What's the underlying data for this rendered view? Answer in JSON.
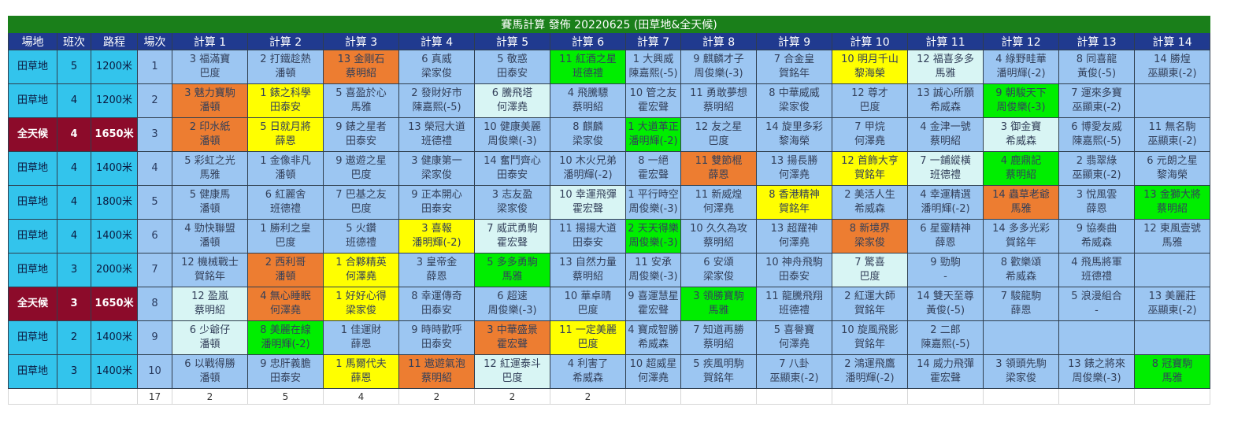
{
  "title": "賽馬計算 發佈 20220625 (田草地&全天候)",
  "headers": [
    "場地",
    "班次",
    "路程",
    "場次",
    "計算 1",
    "計算 2",
    "計算 3",
    "計算 4",
    "計算 5",
    "計算 6",
    "計算 7",
    "計算 8",
    "計算 9",
    "計算 10",
    "計算 11",
    "計算 12",
    "計算 13",
    "計算 14"
  ],
  "colors": {
    "dark": "#9cc6f2",
    "light": "#d8f5f4",
    "orange": "#ed7d31",
    "yellow": "#ffff00",
    "green": "#00ee00",
    "turf": "#33c4ec",
    "awt": "#8c0b2a",
    "header": "#203a8f",
    "title": "#1a7f1a"
  },
  "rows": [
    {
      "venue": "田草地",
      "vt": "v1",
      "cls": "5",
      "dist": "1200米",
      "race": "1",
      "cells": [
        [
          "3 福滿寶",
          "巴度",
          "d"
        ],
        [
          "2 打鐵趁熱",
          "潘頓",
          "d"
        ],
        [
          "13 金剛石",
          "蔡明紹",
          "o"
        ],
        [
          "6 真威",
          "梁家俊",
          "d"
        ],
        [
          "5 敬惑",
          "田泰安",
          "d"
        ],
        [
          "11 紅酒之星",
          "班德禮",
          "g"
        ],
        [
          "1 大興威",
          "陳嘉熙(-5)",
          "d"
        ],
        [
          "9 麒麟才子",
          "周俊樂(-3)",
          "d"
        ],
        [
          "7 合金皇",
          "賀銘年",
          "d"
        ],
        [
          "10 明月千山",
          "黎海榮",
          "y"
        ],
        [
          "12 福喜多多",
          "馬雅",
          "l"
        ],
        [
          "4 綠野畦華",
          "潘明輝(-2)",
          "d"
        ],
        [
          "8 同喜龍",
          "黃俊(-5)",
          "d"
        ],
        [
          "14 勝煌",
          "巫顯東(-2)",
          "d"
        ]
      ]
    },
    {
      "venue": "田草地",
      "vt": "v1",
      "cls": "4",
      "dist": "1200米",
      "race": "2",
      "cells": [
        [
          "3 魅力寶駒",
          "潘頓",
          "o"
        ],
        [
          "1 錶之科學",
          "田泰安",
          "y"
        ],
        [
          "5 喜盈於心",
          "馬雅",
          "d"
        ],
        [
          "2 發財好市",
          "陳嘉熙(-5)",
          "d"
        ],
        [
          "6 騰飛塔",
          "何澤堯",
          "l"
        ],
        [
          "4 飛騰驃",
          "蔡明紹",
          "d"
        ],
        [
          "10 管之友",
          "霍宏聲",
          "d"
        ],
        [
          "11 勇敢夢想",
          "蔡明紹",
          "d"
        ],
        [
          "8 中華威威",
          "梁家俊",
          "d"
        ],
        [
          "12 尊才",
          "巴度",
          "d"
        ],
        [
          "13 誠心所願",
          "希威森",
          "d"
        ],
        [
          "9 朝駿天下",
          "周俊樂(-3)",
          "g"
        ],
        [
          "7 運來多寶",
          "巫顯東(-2)",
          "d"
        ],
        [
          "",
          "",
          "d"
        ]
      ]
    },
    {
      "venue": "全天候",
      "vt": "v2",
      "cls": "4",
      "dist": "1650米",
      "race": "3",
      "cells": [
        [
          "2 印水紙",
          "潘頓",
          "o"
        ],
        [
          "5 日就月將",
          "薛恩",
          "y"
        ],
        [
          "9 錶之星者",
          "田泰安",
          "d"
        ],
        [
          "13 榮冠大道",
          "班德禮",
          "d"
        ],
        [
          "10 健康美麗",
          "周俊樂(-3)",
          "d"
        ],
        [
          "8 麒麟",
          "梁家俊",
          "d"
        ],
        [
          "1 大道革正",
          "潘明輝(-2)",
          "g"
        ],
        [
          "12 友之星",
          "巴度",
          "d"
        ],
        [
          "14 旋里多彩",
          "黎海榮",
          "d"
        ],
        [
          "7 甲烷",
          "何澤堯",
          "d"
        ],
        [
          "4 金津一號",
          "蔡明紹",
          "d"
        ],
        [
          "3 御金寶",
          "希威森",
          "l"
        ],
        [
          "6 博愛友威",
          "陳嘉熙(-5)",
          "d"
        ],
        [
          "11 無名駒",
          "巫顯東(-2)",
          "d"
        ]
      ]
    },
    {
      "venue": "田草地",
      "vt": "v1",
      "cls": "4",
      "dist": "1400米",
      "race": "4",
      "cells": [
        [
          "5 彩虹之光",
          "馬雅",
          "d"
        ],
        [
          "1 金像非凡",
          "潘頓",
          "d"
        ],
        [
          "9 遨遊之星",
          "巴度",
          "d"
        ],
        [
          "3 健康第一",
          "梁家俊",
          "d"
        ],
        [
          "14 奮鬥齊心",
          "田泰安",
          "d"
        ],
        [
          "10 木火兄弟",
          "潘明輝(-2)",
          "d"
        ],
        [
          "8 一絕",
          "霍宏聲",
          "d"
        ],
        [
          "11 雙節棍",
          "薛恩",
          "o"
        ],
        [
          "13 揚長勝",
          "何澤堯",
          "d"
        ],
        [
          "12 首飾大亨",
          "賀銘年",
          "y"
        ],
        [
          "7 一鋪縱橫",
          "班德禮",
          "l"
        ],
        [
          "4 鹿鼎記",
          "蔡明紹",
          "g"
        ],
        [
          "2 翡翠綠",
          "巫顯東(-2)",
          "d"
        ],
        [
          "6 元朗之星",
          "黎海榮",
          "d"
        ]
      ]
    },
    {
      "venue": "田草地",
      "vt": "v1",
      "cls": "4",
      "dist": "1800米",
      "race": "5",
      "cells": [
        [
          "5 健康馬",
          "潘頓",
          "d"
        ],
        [
          "6 紅麗舍",
          "班德禮",
          "d"
        ],
        [
          "7 巴基之友",
          "巴度",
          "d"
        ],
        [
          "9 正本開心",
          "田泰安",
          "d"
        ],
        [
          "3 志友盈",
          "梁家俊",
          "d"
        ],
        [
          "10 幸運飛彈",
          "霍宏聲",
          "l"
        ],
        [
          "1 平行時空",
          "周俊樂(-3)",
          "d"
        ],
        [
          "11 新威煌",
          "何澤堯",
          "d"
        ],
        [
          "8 香港精神",
          "賀銘年",
          "y"
        ],
        [
          "2 美活人生",
          "希威森",
          "d"
        ],
        [
          "4 幸運精選",
          "潘明輝(-2)",
          "d"
        ],
        [
          "14 蟲草老爺",
          "馬雅",
          "o"
        ],
        [
          "3 悅風雲",
          "薛恩",
          "d"
        ],
        [
          "13 金獅大將",
          "蔡明紹",
          "g"
        ]
      ]
    },
    {
      "venue": "田草地",
      "vt": "v1",
      "cls": "4",
      "dist": "1400米",
      "race": "6",
      "cells": [
        [
          "4 勁快聯盟",
          "潘頓",
          "d"
        ],
        [
          "1 勝利之皇",
          "巴度",
          "d"
        ],
        [
          "5 火鑽",
          "班德禮",
          "d"
        ],
        [
          "3 喜報",
          "潘明輝(-2)",
          "y"
        ],
        [
          "7 威武勇駒",
          "霍宏聲",
          "l"
        ],
        [
          "11 揚揚大道",
          "田泰安",
          "d"
        ],
        [
          "2 天天得樂",
          "周俊樂(-3)",
          "g"
        ],
        [
          "10 久久為攻",
          "蔡明紹",
          "d"
        ],
        [
          "13 超躍神",
          "何澤堯",
          "d"
        ],
        [
          "8 新境界",
          "梁家俊",
          "o"
        ],
        [
          "6 星靈精神",
          "薛恩",
          "d"
        ],
        [
          "14 多多光彩",
          "賀銘年",
          "d"
        ],
        [
          "9 協奏曲",
          "希威森",
          "d"
        ],
        [
          "12 東風壹號",
          "馬雅",
          "d"
        ]
      ]
    },
    {
      "venue": "田草地",
      "vt": "v1",
      "cls": "3",
      "dist": "2000米",
      "race": "7",
      "cells": [
        [
          "12 機械戰士",
          "賀銘年",
          "d"
        ],
        [
          "2 西利哥",
          "潘頓",
          "o"
        ],
        [
          "1 合夥精英",
          "何澤堯",
          "y"
        ],
        [
          "3 皇帝金",
          "薛恩",
          "d"
        ],
        [
          "5 多多勇駒",
          "馬雅",
          "g"
        ],
        [
          "13 自然力量",
          "蔡明紹",
          "d"
        ],
        [
          "11 安承",
          "周俊樂(-3)",
          "d"
        ],
        [
          "6 安頌",
          "梁家俊",
          "d"
        ],
        [
          "10 神舟飛駒",
          "田泰安",
          "d"
        ],
        [
          "7 驚喜",
          "巴度",
          "l"
        ],
        [
          "9 勁駒",
          "-",
          "d"
        ],
        [
          "8 歡樂頌",
          "希威森",
          "d"
        ],
        [
          "4 飛馬將軍",
          "班德禮",
          "d"
        ],
        [
          "",
          "",
          "d"
        ]
      ]
    },
    {
      "venue": "全天候",
      "vt": "v2",
      "cls": "3",
      "dist": "1650米",
      "race": "8",
      "cells": [
        [
          "12 盈嵐",
          "蔡明紹",
          "l"
        ],
        [
          "4 無心睡眠",
          "何澤堯",
          "o"
        ],
        [
          "1 好好心得",
          "梁家俊",
          "y"
        ],
        [
          "8 幸運傳奇",
          "田泰安",
          "d"
        ],
        [
          "6 超速",
          "周俊樂(-3)",
          "d"
        ],
        [
          "10 華卓晴",
          "巴度",
          "d"
        ],
        [
          "9 喜運慧星",
          "霍宏聲",
          "d"
        ],
        [
          "3 領勝寶駒",
          "馬雅",
          "g"
        ],
        [
          "11 龍騰飛翔",
          "班德禮",
          "d"
        ],
        [
          "2 紅運大師",
          "賀銘年",
          "d"
        ],
        [
          "14 雙天至尊",
          "黃俊(-5)",
          "d"
        ],
        [
          "7 駿龍駒",
          "薛恩",
          "d"
        ],
        [
          "5 浪漫組合",
          "-",
          "d"
        ],
        [
          "13 美麗莊",
          "巫顯東(-2)",
          "d"
        ]
      ]
    },
    {
      "venue": "田草地",
      "vt": "v1",
      "cls": "2",
      "dist": "1400米",
      "race": "9",
      "cells": [
        [
          "6 少爺仔",
          "潘頓",
          "l"
        ],
        [
          "8 美麗在線",
          "潘明輝(-2)",
          "g"
        ],
        [
          "1 佳運財",
          "薛恩",
          "d"
        ],
        [
          "9 時時歡呼",
          "田泰安",
          "d"
        ],
        [
          "3 中華盛景",
          "霍宏聲",
          "o"
        ],
        [
          "11 一定美麗",
          "巴度",
          "y"
        ],
        [
          "4 寶成智勝",
          "希威森",
          "d"
        ],
        [
          "7 知道再勝",
          "蔡明紹",
          "d"
        ],
        [
          "5 喜譽寶",
          "何澤堯",
          "d"
        ],
        [
          "10 旋風飛影",
          "賀銘年",
          "d"
        ],
        [
          "2 二郎",
          "陳嘉熙(-5)",
          "d"
        ],
        [
          "",
          "",
          "d"
        ],
        [
          "",
          "",
          "d"
        ],
        [
          "",
          "",
          "d"
        ]
      ]
    },
    {
      "venue": "田草地",
      "vt": "v1",
      "cls": "3",
      "dist": "1400米",
      "race": "10",
      "cells": [
        [
          "6 以戰得勝",
          "潘頓",
          "d"
        ],
        [
          "9 忠肝義膽",
          "田泰安",
          "d"
        ],
        [
          "1 馬爾代夫",
          "薛恩",
          "y"
        ],
        [
          "11 遨遊氣泡",
          "蔡明紹",
          "o"
        ],
        [
          "12 紅運泰斗",
          "巴度",
          "l"
        ],
        [
          "4 利害了",
          "希威森",
          "d"
        ],
        [
          "10 超威星",
          "何澤堯",
          "d"
        ],
        [
          "5 疾風明駒",
          "賀銘年",
          "d"
        ],
        [
          "7 八卦",
          "巫顯東(-2)",
          "d"
        ],
        [
          "2 鴻運飛鷹",
          "潘明輝(-2)",
          "d"
        ],
        [
          "14 威力飛彈",
          "霍宏聲",
          "d"
        ],
        [
          "3 領頭先駒",
          "梁家俊",
          "d"
        ],
        [
          "13 錶之將來",
          "周俊樂(-3)",
          "d"
        ],
        [
          "8 冠寶駒",
          "馬雅",
          "g"
        ]
      ]
    }
  ],
  "footer": [
    "",
    "",
    "",
    "17",
    "2",
    "5",
    "4",
    "2",
    "2",
    "2",
    "",
    "",
    "",
    "",
    "",
    "",
    "",
    ""
  ]
}
